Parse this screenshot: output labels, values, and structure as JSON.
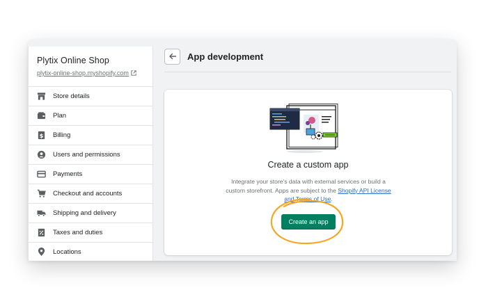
{
  "store": {
    "name": "Plytix Online Shop",
    "url": "plytix-online-shop.myshopify.com"
  },
  "sidebar": {
    "items": [
      {
        "label": "Store details",
        "icon": "store-icon"
      },
      {
        "label": "Plan",
        "icon": "plan-icon"
      },
      {
        "label": "Billing",
        "icon": "billing-icon"
      },
      {
        "label": "Users and permissions",
        "icon": "user-icon"
      },
      {
        "label": "Payments",
        "icon": "payments-icon"
      },
      {
        "label": "Checkout and accounts",
        "icon": "cart-icon"
      },
      {
        "label": "Shipping and delivery",
        "icon": "truck-icon"
      },
      {
        "label": "Taxes and duties",
        "icon": "tax-icon"
      },
      {
        "label": "Locations",
        "icon": "location-icon"
      }
    ]
  },
  "header": {
    "title": "App development"
  },
  "card": {
    "title": "Create a custom app",
    "desc_part1": "Integrate your store's data with external services or build a custom storefront. Apps are subject to the ",
    "link_text": "Shopify API License and Terms of Use",
    "desc_part2": ".",
    "button_label": "Create an app"
  },
  "colors": {
    "primary": "#008060",
    "link": "#2c6ecb",
    "annotation": "#f5a623"
  }
}
